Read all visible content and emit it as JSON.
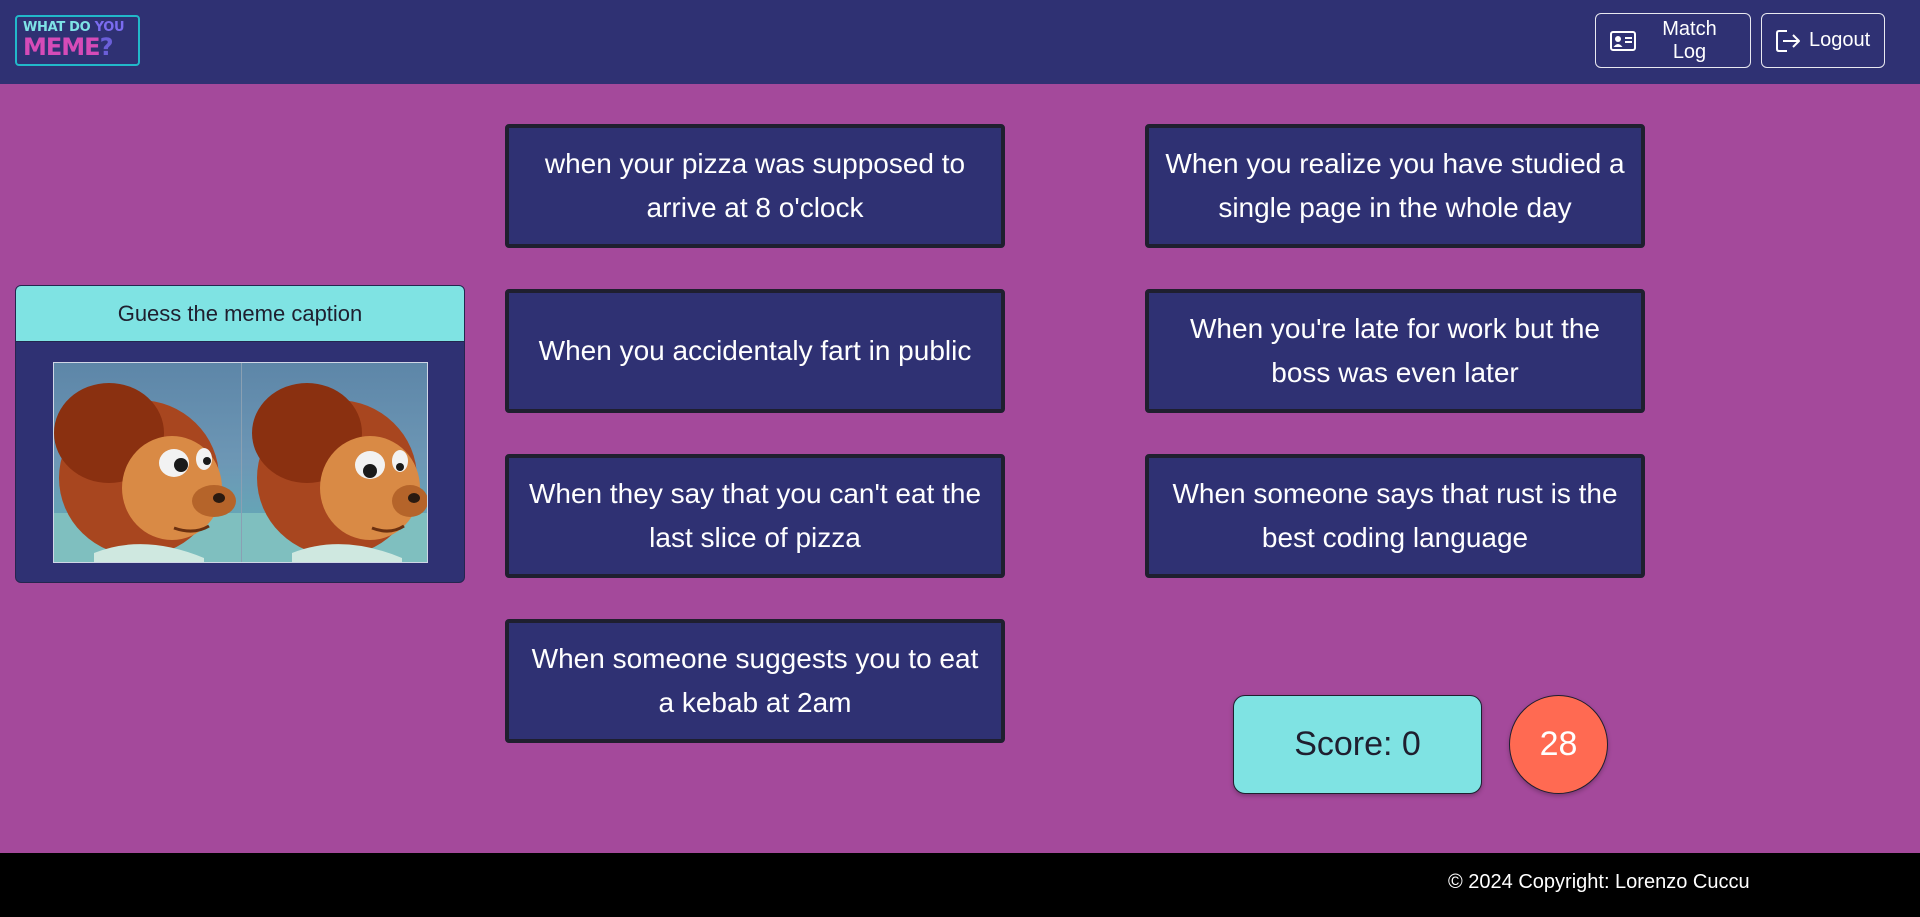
{
  "header": {
    "logo": {
      "line1": "WHAT DO",
      "line1_accent": "YOU",
      "line2": "MEME",
      "line2_accent": "?"
    },
    "match_log_label": "Match Log",
    "logout_label": "Logout",
    "icons": {
      "match_log": "id-card-icon",
      "logout": "logout-icon"
    }
  },
  "meme_card": {
    "title": "Guess the meme caption",
    "image": "monkey-puppet-side-eye-meme"
  },
  "captions": [
    "when your pizza was supposed to arrive at 8 o'clock",
    "When you realize you have studied a single page in the whole day",
    "When you accidentaly fart in public",
    "When you're late for work but the boss was even later",
    "When they say that you can't eat the last slice of pizza",
    "When someone says that rust is the best coding language",
    "When someone suggests you to eat a kebab at 2am"
  ],
  "score": {
    "label": "Score: 0"
  },
  "timer": {
    "value": "28"
  },
  "footer": {
    "text": "© 2024 Copyright: Lorenzo Cuccu"
  },
  "colors": {
    "background": "#a4499b",
    "navbar": "#2f3173",
    "card": "#2f3173",
    "accent_cyan": "#7fe3e3",
    "timer_red": "#ff6a52",
    "footer": "#000000"
  }
}
